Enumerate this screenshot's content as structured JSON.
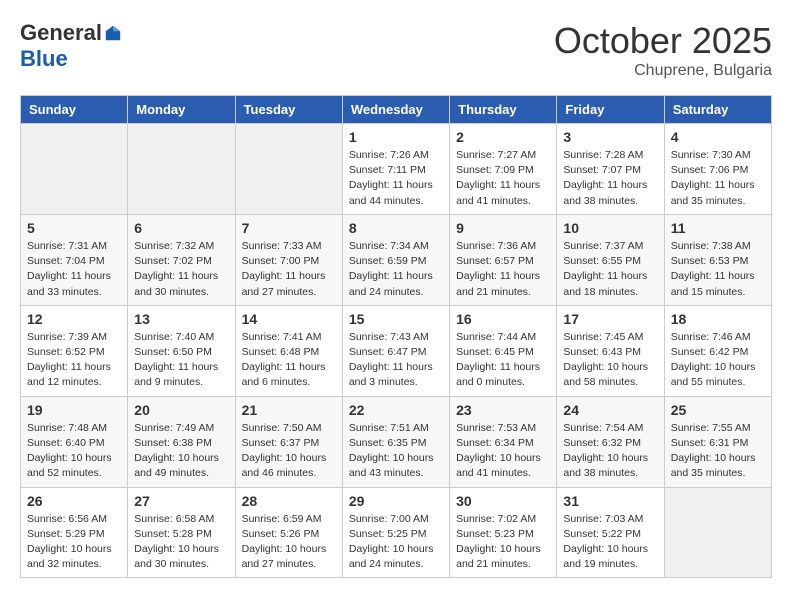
{
  "header": {
    "logo_general": "General",
    "logo_blue": "Blue",
    "month_title": "October 2025",
    "location": "Chuprene, Bulgaria"
  },
  "days_of_week": [
    "Sunday",
    "Monday",
    "Tuesday",
    "Wednesday",
    "Thursday",
    "Friday",
    "Saturday"
  ],
  "weeks": [
    [
      {
        "day": "",
        "sunrise": "",
        "sunset": "",
        "daylight": "",
        "empty": true
      },
      {
        "day": "",
        "sunrise": "",
        "sunset": "",
        "daylight": "",
        "empty": true
      },
      {
        "day": "",
        "sunrise": "",
        "sunset": "",
        "daylight": "",
        "empty": true
      },
      {
        "day": "1",
        "sunrise": "Sunrise: 7:26 AM",
        "sunset": "Sunset: 7:11 PM",
        "daylight": "Daylight: 11 hours and 44 minutes."
      },
      {
        "day": "2",
        "sunrise": "Sunrise: 7:27 AM",
        "sunset": "Sunset: 7:09 PM",
        "daylight": "Daylight: 11 hours and 41 minutes."
      },
      {
        "day": "3",
        "sunrise": "Sunrise: 7:28 AM",
        "sunset": "Sunset: 7:07 PM",
        "daylight": "Daylight: 11 hours and 38 minutes."
      },
      {
        "day": "4",
        "sunrise": "Sunrise: 7:30 AM",
        "sunset": "Sunset: 7:06 PM",
        "daylight": "Daylight: 11 hours and 35 minutes."
      }
    ],
    [
      {
        "day": "5",
        "sunrise": "Sunrise: 7:31 AM",
        "sunset": "Sunset: 7:04 PM",
        "daylight": "Daylight: 11 hours and 33 minutes."
      },
      {
        "day": "6",
        "sunrise": "Sunrise: 7:32 AM",
        "sunset": "Sunset: 7:02 PM",
        "daylight": "Daylight: 11 hours and 30 minutes."
      },
      {
        "day": "7",
        "sunrise": "Sunrise: 7:33 AM",
        "sunset": "Sunset: 7:00 PM",
        "daylight": "Daylight: 11 hours and 27 minutes."
      },
      {
        "day": "8",
        "sunrise": "Sunrise: 7:34 AM",
        "sunset": "Sunset: 6:59 PM",
        "daylight": "Daylight: 11 hours and 24 minutes."
      },
      {
        "day": "9",
        "sunrise": "Sunrise: 7:36 AM",
        "sunset": "Sunset: 6:57 PM",
        "daylight": "Daylight: 11 hours and 21 minutes."
      },
      {
        "day": "10",
        "sunrise": "Sunrise: 7:37 AM",
        "sunset": "Sunset: 6:55 PM",
        "daylight": "Daylight: 11 hours and 18 minutes."
      },
      {
        "day": "11",
        "sunrise": "Sunrise: 7:38 AM",
        "sunset": "Sunset: 6:53 PM",
        "daylight": "Daylight: 11 hours and 15 minutes."
      }
    ],
    [
      {
        "day": "12",
        "sunrise": "Sunrise: 7:39 AM",
        "sunset": "Sunset: 6:52 PM",
        "daylight": "Daylight: 11 hours and 12 minutes."
      },
      {
        "day": "13",
        "sunrise": "Sunrise: 7:40 AM",
        "sunset": "Sunset: 6:50 PM",
        "daylight": "Daylight: 11 hours and 9 minutes."
      },
      {
        "day": "14",
        "sunrise": "Sunrise: 7:41 AM",
        "sunset": "Sunset: 6:48 PM",
        "daylight": "Daylight: 11 hours and 6 minutes."
      },
      {
        "day": "15",
        "sunrise": "Sunrise: 7:43 AM",
        "sunset": "Sunset: 6:47 PM",
        "daylight": "Daylight: 11 hours and 3 minutes."
      },
      {
        "day": "16",
        "sunrise": "Sunrise: 7:44 AM",
        "sunset": "Sunset: 6:45 PM",
        "daylight": "Daylight: 11 hours and 0 minutes."
      },
      {
        "day": "17",
        "sunrise": "Sunrise: 7:45 AM",
        "sunset": "Sunset: 6:43 PM",
        "daylight": "Daylight: 10 hours and 58 minutes."
      },
      {
        "day": "18",
        "sunrise": "Sunrise: 7:46 AM",
        "sunset": "Sunset: 6:42 PM",
        "daylight": "Daylight: 10 hours and 55 minutes."
      }
    ],
    [
      {
        "day": "19",
        "sunrise": "Sunrise: 7:48 AM",
        "sunset": "Sunset: 6:40 PM",
        "daylight": "Daylight: 10 hours and 52 minutes."
      },
      {
        "day": "20",
        "sunrise": "Sunrise: 7:49 AM",
        "sunset": "Sunset: 6:38 PM",
        "daylight": "Daylight: 10 hours and 49 minutes."
      },
      {
        "day": "21",
        "sunrise": "Sunrise: 7:50 AM",
        "sunset": "Sunset: 6:37 PM",
        "daylight": "Daylight: 10 hours and 46 minutes."
      },
      {
        "day": "22",
        "sunrise": "Sunrise: 7:51 AM",
        "sunset": "Sunset: 6:35 PM",
        "daylight": "Daylight: 10 hours and 43 minutes."
      },
      {
        "day": "23",
        "sunrise": "Sunrise: 7:53 AM",
        "sunset": "Sunset: 6:34 PM",
        "daylight": "Daylight: 10 hours and 41 minutes."
      },
      {
        "day": "24",
        "sunrise": "Sunrise: 7:54 AM",
        "sunset": "Sunset: 6:32 PM",
        "daylight": "Daylight: 10 hours and 38 minutes."
      },
      {
        "day": "25",
        "sunrise": "Sunrise: 7:55 AM",
        "sunset": "Sunset: 6:31 PM",
        "daylight": "Daylight: 10 hours and 35 minutes."
      }
    ],
    [
      {
        "day": "26",
        "sunrise": "Sunrise: 6:56 AM",
        "sunset": "Sunset: 5:29 PM",
        "daylight": "Daylight: 10 hours and 32 minutes."
      },
      {
        "day": "27",
        "sunrise": "Sunrise: 6:58 AM",
        "sunset": "Sunset: 5:28 PM",
        "daylight": "Daylight: 10 hours and 30 minutes."
      },
      {
        "day": "28",
        "sunrise": "Sunrise: 6:59 AM",
        "sunset": "Sunset: 5:26 PM",
        "daylight": "Daylight: 10 hours and 27 minutes."
      },
      {
        "day": "29",
        "sunrise": "Sunrise: 7:00 AM",
        "sunset": "Sunset: 5:25 PM",
        "daylight": "Daylight: 10 hours and 24 minutes."
      },
      {
        "day": "30",
        "sunrise": "Sunrise: 7:02 AM",
        "sunset": "Sunset: 5:23 PM",
        "daylight": "Daylight: 10 hours and 21 minutes."
      },
      {
        "day": "31",
        "sunrise": "Sunrise: 7:03 AM",
        "sunset": "Sunset: 5:22 PM",
        "daylight": "Daylight: 10 hours and 19 minutes."
      },
      {
        "day": "",
        "sunrise": "",
        "sunset": "",
        "daylight": "",
        "empty": true
      }
    ]
  ]
}
